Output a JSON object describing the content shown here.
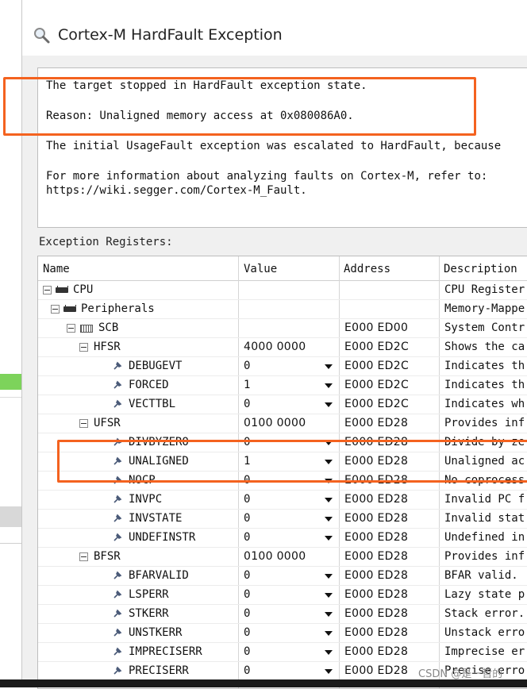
{
  "window": {
    "title": "Cortex-M HardFault Exception",
    "icon": "magnifier-icon"
  },
  "message": {
    "line1": "The target stopped in HardFault exception state.",
    "line2": "Reason: Unaligned memory access at 0x080086A0.",
    "line3": "The initial UsageFault exception was escalated to HardFault, because",
    "line4": "For more information about analyzing faults on Cortex-M, refer to:",
    "line5": "https://wiki.segger.com/Cortex-M_Fault."
  },
  "registers": {
    "label": "Exception Registers:",
    "columns": [
      "Name",
      "Value",
      "Address",
      "Description"
    ],
    "rows": [
      {
        "name": "CPU",
        "value": "",
        "address": "",
        "description": "CPU Register",
        "level": 0,
        "kind": "group",
        "icon": "chip-icon"
      },
      {
        "name": "Peripherals",
        "value": "",
        "address": "",
        "description": "Memory-Mappe",
        "level": 1,
        "kind": "group",
        "icon": "chip-icon"
      },
      {
        "name": "SCB",
        "value": "",
        "address": "E000 ED00",
        "description": "System Contr",
        "level": 2,
        "kind": "group",
        "icon": "register-block-icon"
      },
      {
        "name": "HFSR",
        "value": "4000 0000",
        "address": "E000 ED2C",
        "description": "Shows the ca",
        "level": 3,
        "kind": "register"
      },
      {
        "name": "DEBUGEVT",
        "value": "0",
        "address": "E000 ED2C",
        "description": "Indicates th",
        "level": 4,
        "kind": "field"
      },
      {
        "name": "FORCED",
        "value": "1",
        "address": "E000 ED2C",
        "description": "Indicates th",
        "level": 4,
        "kind": "field"
      },
      {
        "name": "VECTTBL",
        "value": "0",
        "address": "E000 ED2C",
        "description": "Indicates wh",
        "level": 4,
        "kind": "field"
      },
      {
        "name": "UFSR",
        "value": "0100 0000",
        "address": "E000 ED28",
        "description": "Provides inf",
        "level": 3,
        "kind": "register"
      },
      {
        "name": "DIVBYZERO",
        "value": "0",
        "address": "E000 ED28",
        "description": "Divide by ze",
        "level": 4,
        "kind": "field"
      },
      {
        "name": "UNALIGNED",
        "value": "1",
        "address": "E000 ED28",
        "description": "Unaligned ac",
        "level": 4,
        "kind": "field"
      },
      {
        "name": "NOCP",
        "value": "0",
        "address": "E000 ED28",
        "description": "No coprocess",
        "level": 4,
        "kind": "field"
      },
      {
        "name": "INVPC",
        "value": "0",
        "address": "E000 ED28",
        "description": "Invalid PC f",
        "level": 4,
        "kind": "field"
      },
      {
        "name": "INVSTATE",
        "value": "0",
        "address": "E000 ED28",
        "description": "Invalid stat",
        "level": 4,
        "kind": "field"
      },
      {
        "name": "UNDEFINSTR",
        "value": "0",
        "address": "E000 ED28",
        "description": "Undefined in",
        "level": 4,
        "kind": "field"
      },
      {
        "name": "BFSR",
        "value": "0100 0000",
        "address": "E000 ED28",
        "description": "Provides inf",
        "level": 3,
        "kind": "register"
      },
      {
        "name": "BFARVALID",
        "value": "0",
        "address": "E000 ED28",
        "description": "BFAR valid.",
        "level": 4,
        "kind": "field"
      },
      {
        "name": "LSPERR",
        "value": "0",
        "address": "E000 ED28",
        "description": "Lazy state p",
        "level": 4,
        "kind": "field"
      },
      {
        "name": "STKERR",
        "value": "0",
        "address": "E000 ED28",
        "description": "Stack error.",
        "level": 4,
        "kind": "field"
      },
      {
        "name": "UNSTKERR",
        "value": "0",
        "address": "E000 ED28",
        "description": "Unstack erro",
        "level": 4,
        "kind": "field"
      },
      {
        "name": "IMPRECISERR",
        "value": "0",
        "address": "E000 ED28",
        "description": "Imprecise er",
        "level": 4,
        "kind": "field"
      },
      {
        "name": "PRECISERR",
        "value": "0",
        "address": "E000 ED28",
        "description": "Precise erro",
        "level": 4,
        "kind": "field"
      }
    ]
  },
  "watermark": "CSDN @是一哲的",
  "colors": {
    "highlight": "#f4621f",
    "status_green": "#7dd35b"
  }
}
